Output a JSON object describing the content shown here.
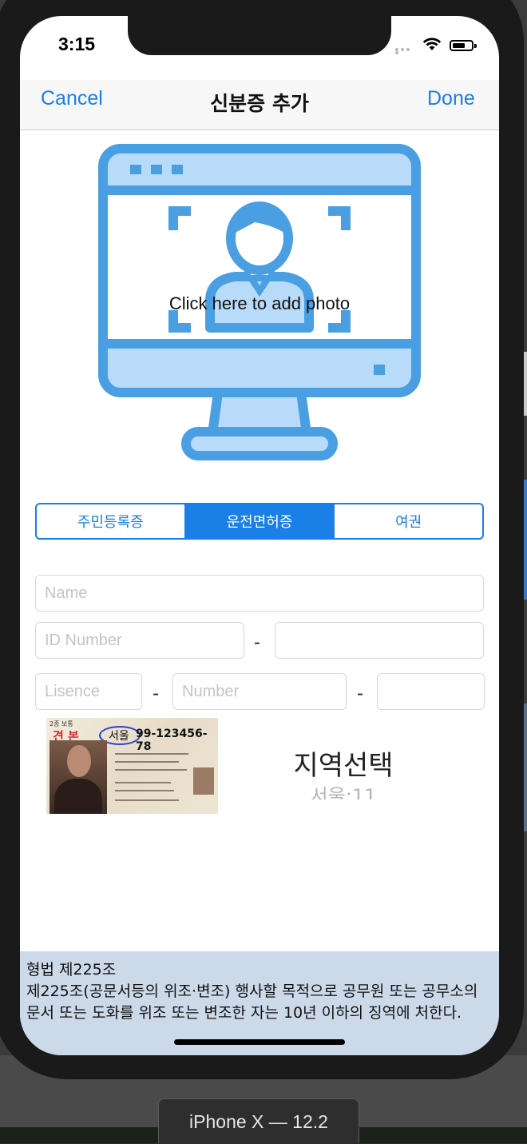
{
  "status_bar": {
    "time": "3:15"
  },
  "navbar": {
    "cancel_label": "Cancel",
    "title": "신분증 추가",
    "done_label": "Done"
  },
  "photo": {
    "label": "Click here to add photo",
    "icon": "monitor-user-icon",
    "icon_color": "#4a9fe3"
  },
  "segments": {
    "items": [
      "주민등록증",
      "운전면허증",
      "여권"
    ],
    "selected": "운전면허증"
  },
  "form": {
    "name_placeholder": "Name",
    "id_placeholder": "ID Number",
    "id_second_placeholder": "",
    "license_placeholder": "Lisence",
    "number_placeholder": "Number",
    "third_placeholder": "",
    "separator": "-"
  },
  "license_sample": {
    "type": "2종 보통",
    "hanja": "견 본",
    "region": "서울",
    "number": "99-123456-78"
  },
  "region_picker": {
    "title": "지역선택",
    "value": "서울:11"
  },
  "footer": {
    "law_title": "형법 제225조",
    "law_text": "제225조(공문서등의 위조·변조) 행사할 목적으로 공무원 또는 공무소의 문서 또는 도화를 위조 또는 변조한 자는 10년 이하의 징역에 처한다."
  },
  "device_label": "iPhone X — 12.2",
  "colors": {
    "accent": "#1a7fe6",
    "footer_bg": "#ccd9e8"
  }
}
